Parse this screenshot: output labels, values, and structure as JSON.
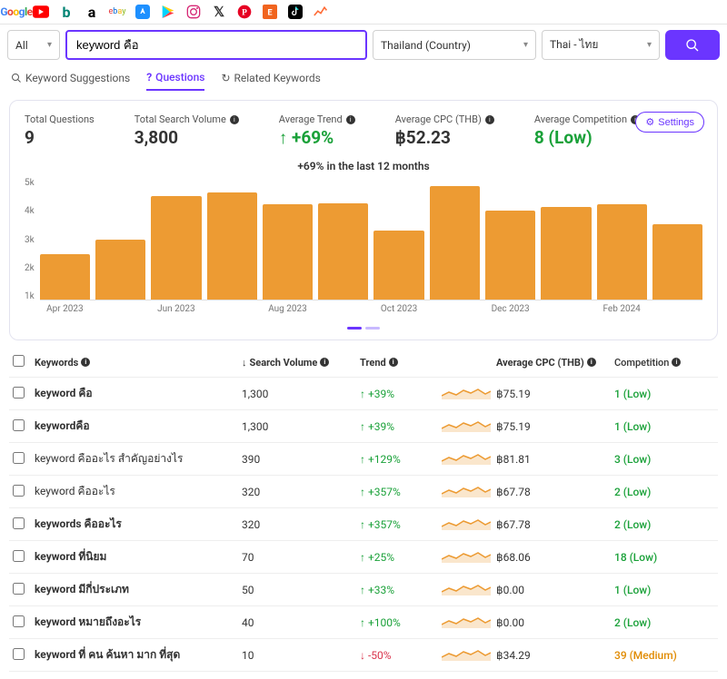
{
  "toolbar": {
    "google_label": "Google"
  },
  "filters": {
    "all_label": "All",
    "keyword_value": "keyword คือ",
    "country_label": "Thailand (Country)",
    "language_label": "Thai - ไทย"
  },
  "tabs": {
    "suggestions": "Keyword Suggestions",
    "questions": "Questions",
    "related": "Related Keywords"
  },
  "stats": {
    "total_questions_label": "Total Questions",
    "total_questions_value": "9",
    "total_volume_label": "Total Search Volume",
    "total_volume_value": "3,800",
    "avg_trend_label": "Average Trend",
    "avg_trend_value": "+69%",
    "avg_cpc_label": "Average CPC (THB)",
    "avg_cpc_value": "฿52.23",
    "avg_comp_label": "Average Competition",
    "avg_comp_value": "8 (Low)",
    "settings_label": "Settings"
  },
  "chart_data": {
    "type": "bar",
    "title": "+69% in the last 12 months",
    "ylim": [
      0,
      5000
    ],
    "yticks": [
      "5k",
      "4k",
      "3k",
      "2k",
      "1k"
    ],
    "categories": [
      "Apr 2023",
      "",
      "Jun 2023",
      "",
      "Aug 2023",
      "",
      "Oct 2023",
      "",
      "Dec 2023",
      "",
      "Feb 2024",
      ""
    ],
    "values": [
      1850,
      2450,
      4250,
      4400,
      3900,
      3950,
      2850,
      4650,
      3650,
      3800,
      3900,
      3100
    ]
  },
  "columns": {
    "keywords": "Keywords",
    "search_volume": "Search Volume",
    "trend": "Trend",
    "avg_cpc": "Average CPC (THB)",
    "competition": "Competition"
  },
  "rows": [
    {
      "kw": "keyword คือ",
      "bold": true,
      "sv": "1,300",
      "trend": "+39%",
      "dir": "up",
      "cpc": "฿75.19",
      "comp": "1 (Low)",
      "comp_level": "low"
    },
    {
      "kw": "keywordคือ",
      "bold": true,
      "sv": "1,300",
      "trend": "+39%",
      "dir": "up",
      "cpc": "฿75.19",
      "comp": "1 (Low)",
      "comp_level": "low"
    },
    {
      "kw": "keyword คืออะไร สำคัญอย่างไร",
      "bold": false,
      "sv": "390",
      "trend": "+129%",
      "dir": "up",
      "cpc": "฿81.81",
      "comp": "3 (Low)",
      "comp_level": "low"
    },
    {
      "kw": "keyword คืออะไร",
      "bold": false,
      "sv": "320",
      "trend": "+357%",
      "dir": "up",
      "cpc": "฿67.78",
      "comp": "2 (Low)",
      "comp_level": "low"
    },
    {
      "kw": "keywords คืออะไร",
      "bold": true,
      "sv": "320",
      "trend": "+357%",
      "dir": "up",
      "cpc": "฿67.78",
      "comp": "2 (Low)",
      "comp_level": "low"
    },
    {
      "kw": "keyword ที่นิยม",
      "bold": true,
      "sv": "70",
      "trend": "+25%",
      "dir": "up",
      "cpc": "฿68.06",
      "comp": "18 (Low)",
      "comp_level": "low"
    },
    {
      "kw": "keyword มีกี่ประเภท",
      "bold": true,
      "sv": "50",
      "trend": "+33%",
      "dir": "up",
      "cpc": "฿0.00",
      "comp": "1 (Low)",
      "comp_level": "low"
    },
    {
      "kw": "keyword หมายถึงอะไร",
      "bold": true,
      "sv": "40",
      "trend": "+100%",
      "dir": "up",
      "cpc": "฿0.00",
      "comp": "2 (Low)",
      "comp_level": "low"
    },
    {
      "kw": "keyword ที่ คน ค้นหา มาก ที่สุด",
      "bold": true,
      "sv": "10",
      "trend": "-50%",
      "dir": "down",
      "cpc": "฿34.29",
      "comp": "39 (Medium)",
      "comp_level": "med"
    }
  ]
}
